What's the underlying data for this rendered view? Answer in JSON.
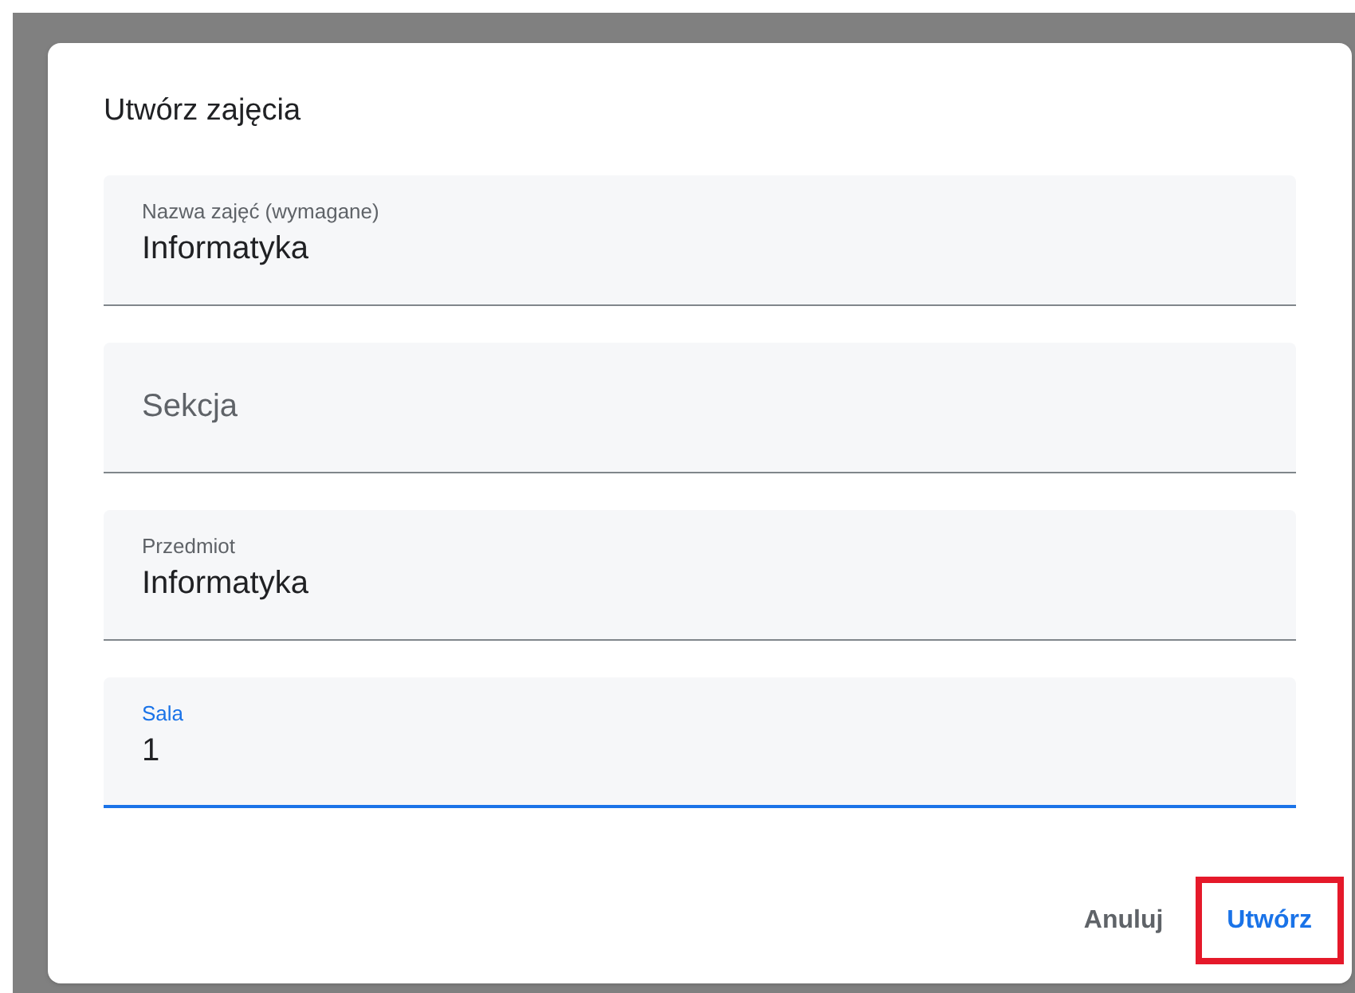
{
  "dialog": {
    "title": "Utwórz zajęcia",
    "fields": [
      {
        "kind": "filled",
        "label": "Nazwa zajęć (wymagane)",
        "value": "Informatyka",
        "focused": false
      },
      {
        "kind": "empty",
        "placeholder": "Sekcja",
        "focused": false
      },
      {
        "kind": "filled",
        "label": "Przedmiot",
        "value": "Informatyka",
        "focused": false
      },
      {
        "kind": "filled",
        "label": "Sala",
        "value": "1",
        "focused": true
      }
    ],
    "buttons": [
      {
        "label": "Anuluj",
        "primary": false,
        "highlighted": false
      },
      {
        "label": "Utwórz",
        "primary": true,
        "highlighted": true
      }
    ]
  }
}
